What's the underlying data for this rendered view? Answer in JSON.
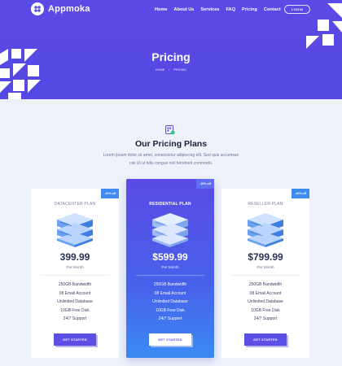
{
  "brand": {
    "name": "Appmoka"
  },
  "nav": {
    "items": [
      "Home",
      "About Us",
      "Services",
      "FAQ",
      "Pricing",
      "Contact"
    ],
    "login_label": "LOGIN"
  },
  "hero": {
    "title": "Pricing",
    "breadcrumb": [
      "HOME",
      "/",
      "PRICING"
    ]
  },
  "section": {
    "title": "Our Pricing Plans",
    "description": "Lorem ipsum dolor sit amet, consectetur adipiscing elit. Sed quis accumsan nisi Ut ut felis congue nisl hendrerit commodo."
  },
  "plans": [
    {
      "name": "DATACENTER PLAN",
      "badge": "-10% off",
      "price": "399.99",
      "period": "Per Month",
      "features": [
        "250GB Bandwidth",
        "08 Email Account",
        "Unlimited Database",
        "10GB Free Disk",
        "24/7 Support"
      ],
      "button": "GET STARTED"
    },
    {
      "name": "RESIDENTIAL PLAN",
      "badge": "-10% off",
      "price": "$599.99",
      "period": "Per Month",
      "features": [
        "250GB Bandwidth",
        "08 Email Account",
        "Unlimited Database",
        "10GB Free Disk",
        "24/7 Support"
      ],
      "button": "GET STARTED"
    },
    {
      "name": "RESELLER PLAN",
      "badge": "-10% off",
      "price": "$799.99",
      "period": "Per Month",
      "features": [
        "250GB Bandwidth",
        "08 Email Account",
        "Unlimited Database",
        "10GB Free Disk",
        "24/7 Support"
      ],
      "button": "GET STARTED"
    }
  ],
  "colors": {
    "brand": "#5a4ae6",
    "accent_blue": "#3f8cf0",
    "page_background": "#eef3fb",
    "heading": "#1b1f3b"
  }
}
